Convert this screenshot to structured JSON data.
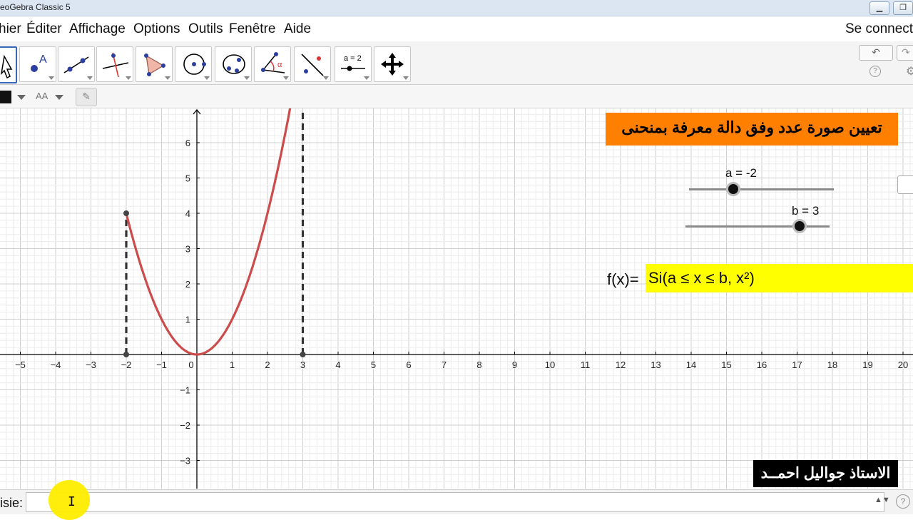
{
  "window": {
    "title": "eoGebra Classic 5",
    "btn_minimize": "▁",
    "btn_restore": "❐"
  },
  "menu": {
    "items": [
      "hier",
      "Éditer",
      "Affichage",
      "Options",
      "Outils",
      "Fenêtre",
      "Aide"
    ],
    "sign_in": "Se connect"
  },
  "toolbar": {
    "tools": [
      {
        "name": "move-tool",
        "icon": "arrow-icon"
      },
      {
        "name": "point-tool",
        "icon": "point-icon"
      },
      {
        "name": "line-tool",
        "icon": "line-icon"
      },
      {
        "name": "perpendicular-tool",
        "icon": "perpendicular-icon"
      },
      {
        "name": "polygon-tool",
        "icon": "polygon-icon"
      },
      {
        "name": "circle-tool",
        "icon": "circle-icon"
      },
      {
        "name": "conic-tool",
        "icon": "ellipse-icon"
      },
      {
        "name": "angle-tool",
        "icon": "angle-icon"
      },
      {
        "name": "reflect-tool",
        "icon": "reflect-icon"
      },
      {
        "name": "slider-tool",
        "icon": "slider-icon",
        "label": "a = 2"
      },
      {
        "name": "move-view-tool",
        "icon": "move-view-icon"
      }
    ],
    "undo_icon": "↶",
    "redo_icon": "↷",
    "help_icon": "?",
    "gear_icon": "⚙"
  },
  "stylebar": {
    "text_size_label": "AA",
    "pin_icon": "✎"
  },
  "graph": {
    "x_ticks": [
      "−5",
      "−4",
      "−3",
      "−2",
      "−1",
      "0",
      "1",
      "2",
      "3",
      "4",
      "5",
      "6",
      "7",
      "8",
      "9",
      "10",
      "11",
      "12",
      "13",
      "14",
      "15",
      "16",
      "17",
      "18",
      "19",
      "20"
    ],
    "y_ticks": [
      "6",
      "5",
      "4",
      "3",
      "2",
      "1",
      "−1",
      "−2",
      "−3"
    ],
    "curve_color": "#cc4b4b",
    "function": {
      "x_min": -2,
      "x_max": 3,
      "expression": "x^2"
    },
    "endpoints": [
      [
        -2,
        4
      ],
      [
        -2,
        0
      ],
      [
        3,
        0
      ]
    ],
    "vertical_lines_x": [
      -2,
      3
    ]
  },
  "banner": {
    "text": "تعيين صورة عدد وفق دالة معرفة بمنحنى",
    "color": "#ff8000"
  },
  "sliders": [
    {
      "label": "a = -2",
      "value": -2
    },
    {
      "label": "b = 3",
      "value": 3
    }
  ],
  "formula": {
    "prefix": "f(x)=",
    "body": "Si(a ≤ x ≤ b, x²)"
  },
  "author": {
    "text": "الاستاذ جواليل احمــد"
  },
  "inputbar": {
    "label": "isie:",
    "dropdown_icon": "▲▼",
    "help_icon": "?"
  },
  "cursor": {
    "glyph": "I"
  }
}
